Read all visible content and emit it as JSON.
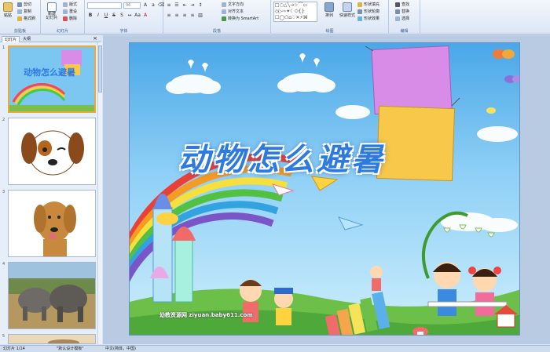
{
  "ribbon": {
    "clipboard": {
      "paste": "粘贴",
      "cut": "剪切",
      "copy": "复制",
      "format_painter": "格式刷",
      "label": "剪贴板"
    },
    "slides": {
      "new_slide": "新建\n幻灯片",
      "layout": "版式",
      "reset": "重设",
      "delete": "删除",
      "label": "幻灯片"
    },
    "font": {
      "size": "96",
      "label": "字体"
    },
    "paragraph": {
      "text_direction": "文字方向",
      "align_text": "对齐文本",
      "smartart": "转换为 SmartArt",
      "label": "段落"
    },
    "drawing": {
      "arrange": "排列",
      "quick_styles": "快速样式",
      "shape_fill": "形状填充",
      "shape_outline": "形状轮廓",
      "shape_effects": "形状效果",
      "label": "绘图"
    },
    "editing": {
      "find": "查找",
      "replace": "替换",
      "select": "选择",
      "label": "编辑"
    }
  },
  "panel": {
    "tabs": [
      "幻灯片",
      "大纲"
    ],
    "slide_numbers": [
      "1",
      "2",
      "3",
      "4",
      "5"
    ]
  },
  "slide": {
    "title": "动物怎么避暑",
    "watermark": "幼教资源网 ziyuan.baby611.com"
  },
  "status": {
    "slide_count": "幻灯片 1/14",
    "theme": "\"默认设计模板\"",
    "language": "中文(简体，中国)"
  },
  "colors": {
    "ribbon_bg": "#dbe6f5",
    "accent": "#2d7be0",
    "selection": "#f0a830"
  }
}
